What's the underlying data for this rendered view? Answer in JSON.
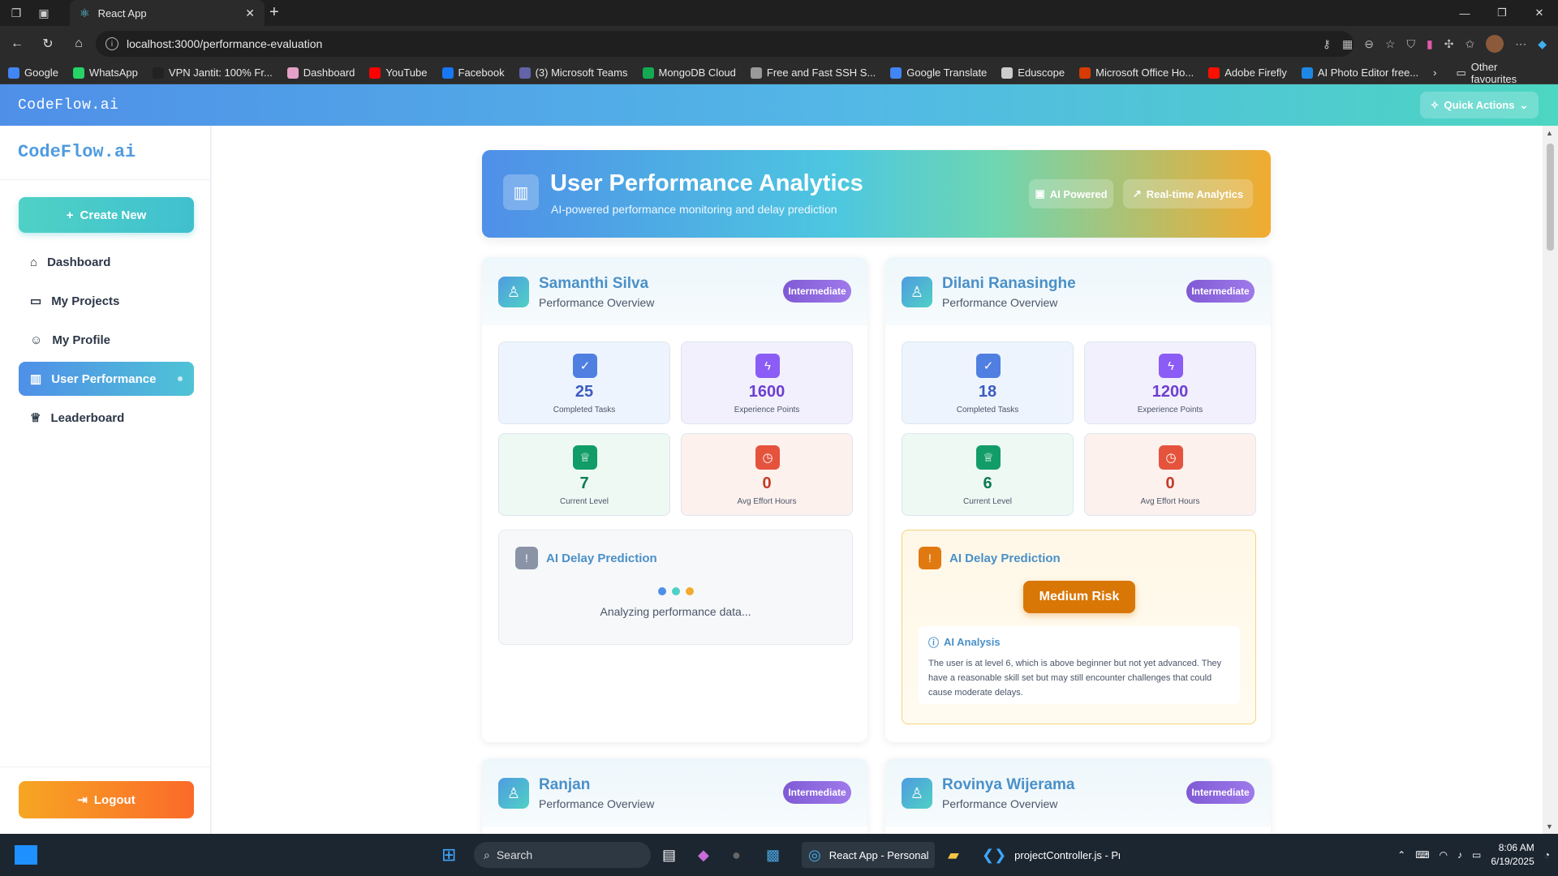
{
  "browser": {
    "tab_title": "React App",
    "url": "localhost:3000/performance-evaluation",
    "bookmarks": [
      {
        "label": "Google",
        "color": "#4285f4"
      },
      {
        "label": "WhatsApp",
        "color": "#25d366"
      },
      {
        "label": "VPN Jantit: 100% Fr...",
        "color": "#222222"
      },
      {
        "label": "Dashboard",
        "color": "#e5a0c8"
      },
      {
        "label": "YouTube",
        "color": "#ff0000"
      },
      {
        "label": "Facebook",
        "color": "#1877f2"
      },
      {
        "label": "(3) Microsoft Teams",
        "color": "#6264a7"
      },
      {
        "label": "MongoDB Cloud",
        "color": "#13aa52"
      },
      {
        "label": "Free and Fast SSH S...",
        "color": "#999999"
      },
      {
        "label": "Google Translate",
        "color": "#4285f4"
      },
      {
        "label": "Eduscope",
        "color": "#cccccc"
      },
      {
        "label": "Microsoft Office Ho...",
        "color": "#d83b01"
      },
      {
        "label": "Adobe Firefly",
        "color": "#fa0f00"
      },
      {
        "label": "AI Photo Editor free...",
        "color": "#1e88e5"
      }
    ],
    "other_favourites": "Other favourites"
  },
  "app": {
    "brand": "CodeFlow.ai",
    "quick_actions": "Quick Actions",
    "sidebar": {
      "brand": "CodeFlow.ai",
      "create_new": "Create New",
      "items": [
        {
          "label": "Dashboard",
          "icon": "home-icon"
        },
        {
          "label": "My Projects",
          "icon": "folder-icon"
        },
        {
          "label": "My Profile",
          "icon": "user-icon"
        },
        {
          "label": "User Performance",
          "icon": "bar-chart-icon",
          "active": true
        },
        {
          "label": "Leaderboard",
          "icon": "trophy-icon"
        }
      ],
      "logout": "Logout"
    },
    "hero": {
      "title": "User Performance Analytics",
      "subtitle": "AI-powered performance monitoring and delay prediction",
      "pill_ai": "AI Powered",
      "pill_rt": "Real-time Analytics"
    },
    "users": [
      {
        "name": "Samanthi Silva",
        "subtitle": "Performance Overview",
        "badge": "Intermediate",
        "completed_tasks": "25",
        "completed_label": "Completed Tasks",
        "xp": "1600",
        "xp_label": "Experience Points",
        "level": "7",
        "level_label": "Current Level",
        "effort": "0",
        "effort_label": "Avg Effort Hours",
        "ai_title": "AI Delay Prediction",
        "ai_status": "Analyzing performance data..."
      },
      {
        "name": "Dilani Ranasinghe",
        "subtitle": "Performance Overview",
        "badge": "Intermediate",
        "completed_tasks": "18",
        "completed_label": "Completed Tasks",
        "xp": "1200",
        "xp_label": "Experience Points",
        "level": "6",
        "level_label": "Current Level",
        "effort": "0",
        "effort_label": "Avg Effort Hours",
        "ai_title": "AI Delay Prediction",
        "risk": "Medium Risk",
        "analysis_title": "AI Analysis",
        "analysis_text": "The user is at level 6, which is above beginner but not yet advanced. They have a reasonable skill set but may still encounter challenges that could cause moderate delays."
      },
      {
        "name": "Ranjan",
        "subtitle": "Performance Overview",
        "badge": "Intermediate"
      },
      {
        "name": "Rovinya Wijerama",
        "subtitle": "Performance Overview",
        "badge": "Intermediate"
      }
    ]
  },
  "taskbar": {
    "search": "Search",
    "edge_app": "React App - Personal - M",
    "vscode_app": "projectController.js - Pr",
    "time": "8:06 AM",
    "date": "6/19/2025"
  }
}
